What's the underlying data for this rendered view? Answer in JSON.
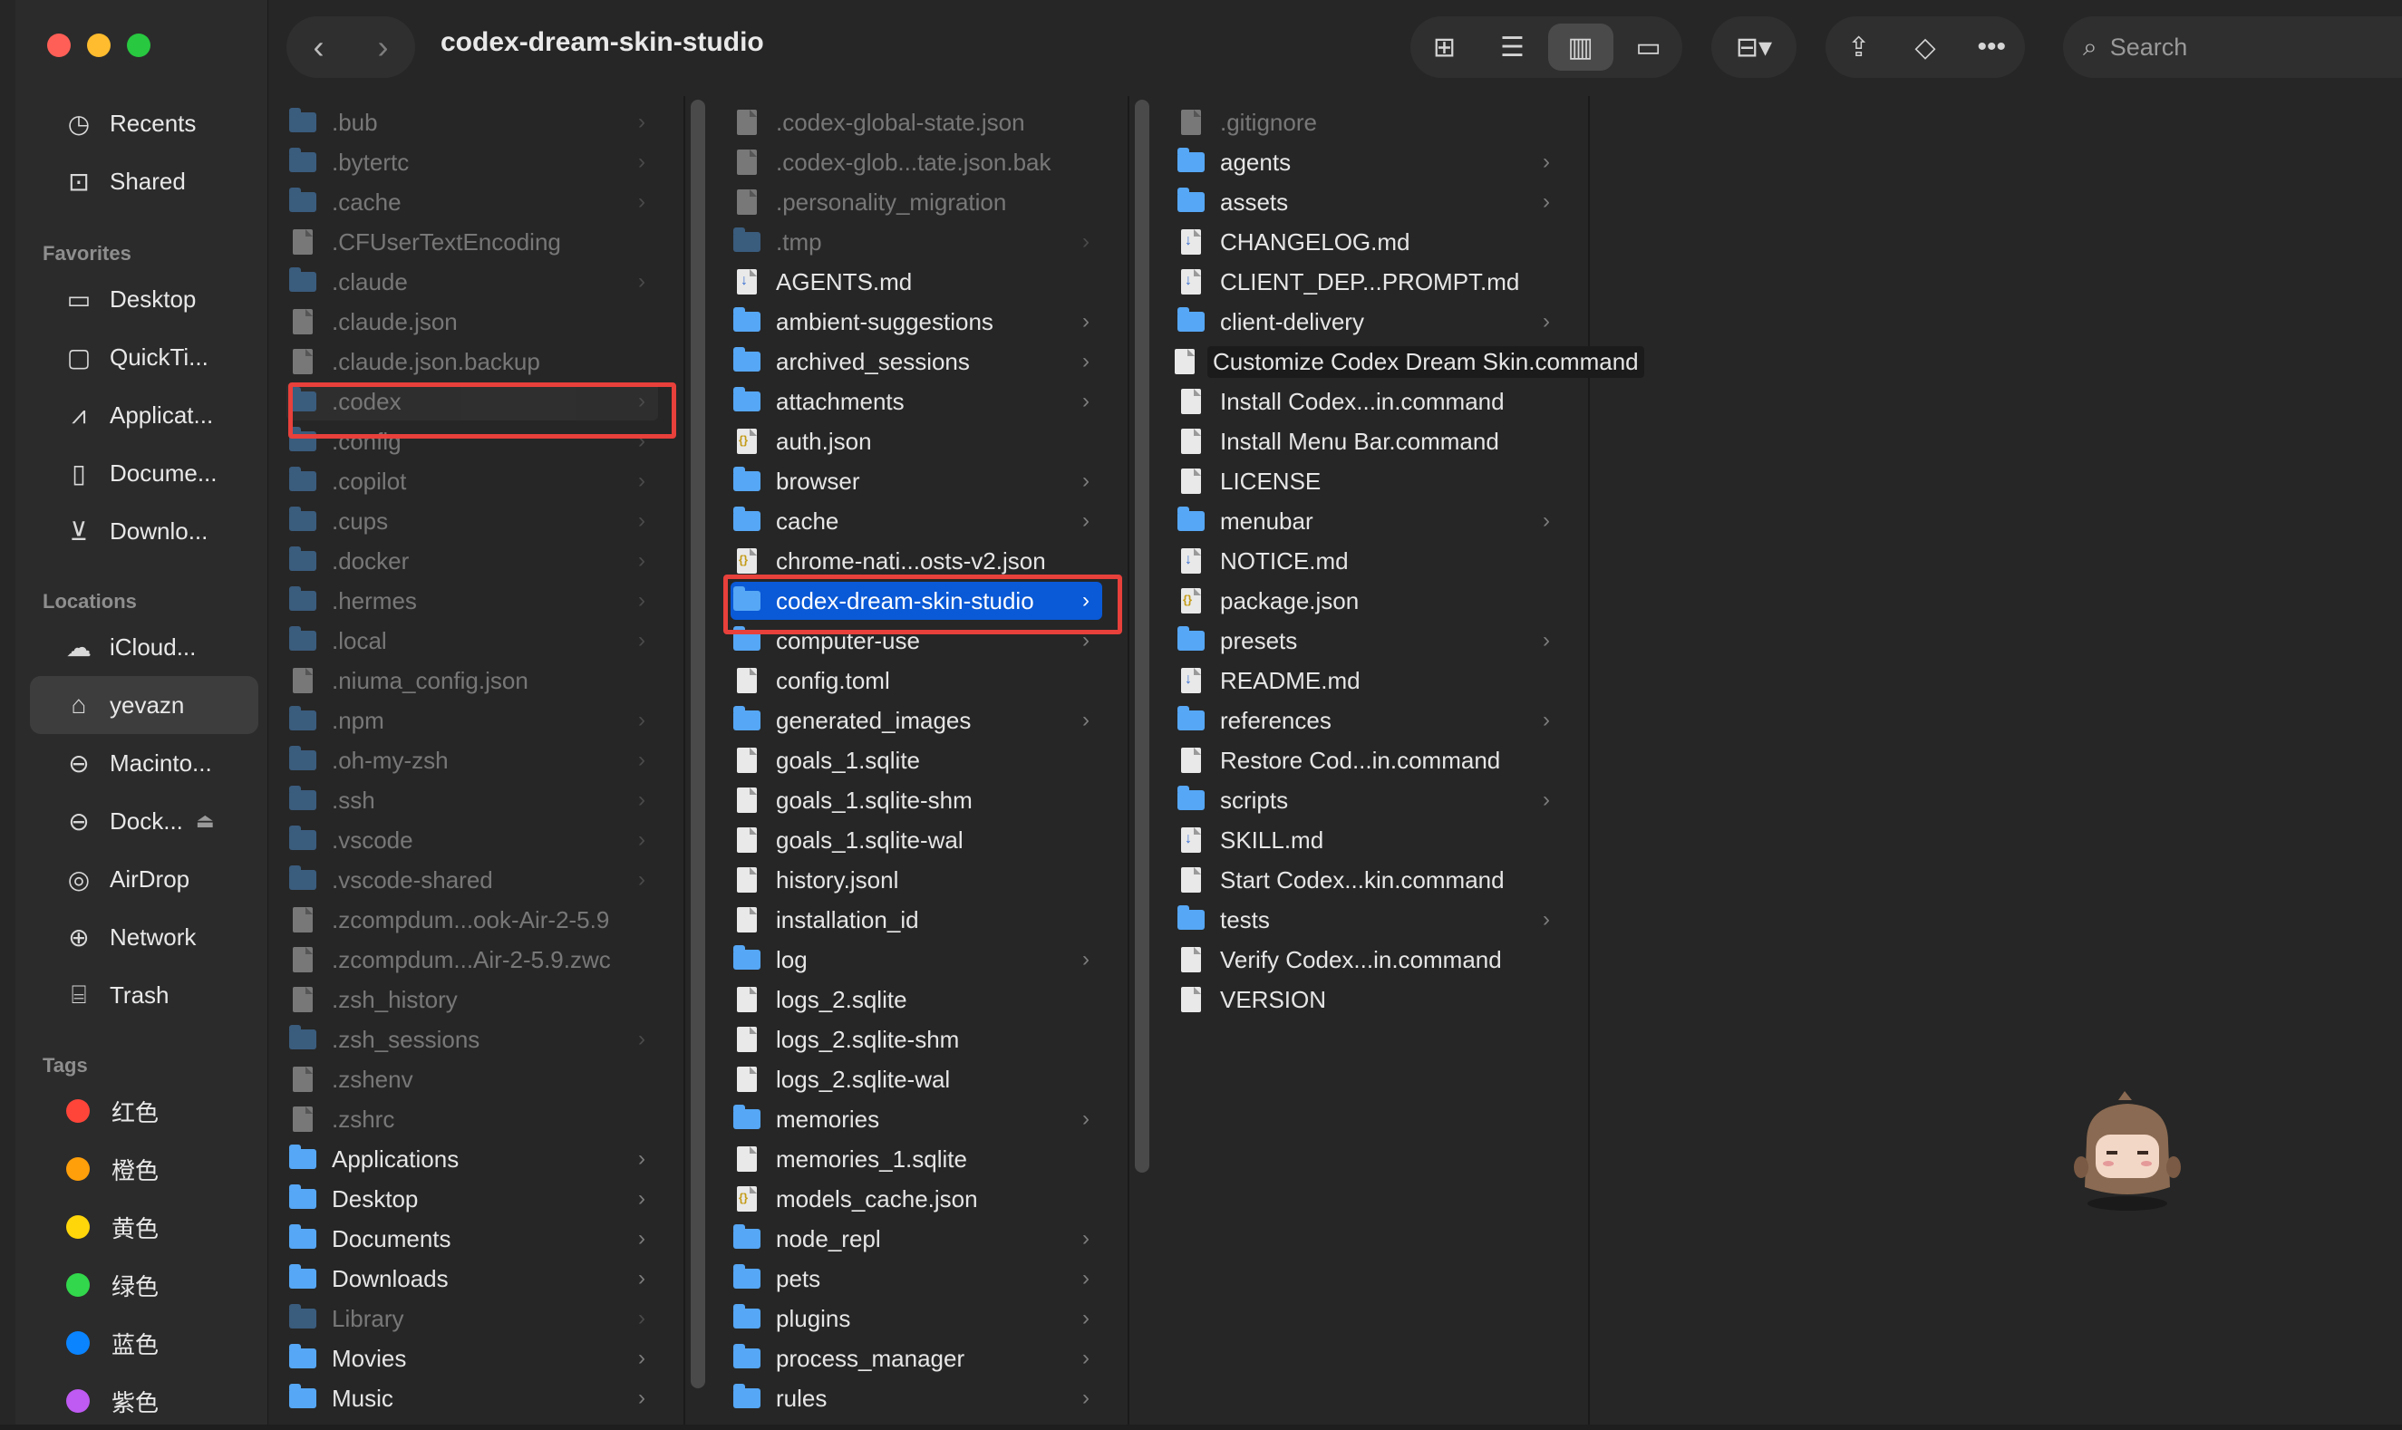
{
  "window": {
    "title": "codex-dream-skin-studio"
  },
  "colors": {
    "accent": "#0a59d6",
    "highlight": "#e8403b",
    "folder": "#56a7f5"
  },
  "sidebar": {
    "top_items": [
      {
        "label": "Recents",
        "icon": "clock-icon"
      },
      {
        "label": "Shared",
        "icon": "shared-folder-icon"
      }
    ],
    "favorites_heading": "Favorites",
    "favorites": [
      {
        "label": "Desktop",
        "icon": "desktop-icon"
      },
      {
        "label": "QuickTi...",
        "icon": "folder-icon"
      },
      {
        "label": "Applicat...",
        "icon": "applications-icon"
      },
      {
        "label": "Docume...",
        "icon": "document-icon"
      },
      {
        "label": "Downlo...",
        "icon": "download-icon"
      }
    ],
    "locations_heading": "Locations",
    "locations": [
      {
        "label": "iCloud...",
        "icon": "cloud-icon"
      },
      {
        "label": "yevazn",
        "icon": "home-icon",
        "active": true
      },
      {
        "label": "Macinto...",
        "icon": "disk-icon"
      },
      {
        "label": "Dock...",
        "icon": "disk-icon",
        "eject": true
      },
      {
        "label": "AirDrop",
        "icon": "airdrop-icon"
      },
      {
        "label": "Network",
        "icon": "globe-icon"
      },
      {
        "label": "Trash",
        "icon": "trash-icon"
      }
    ],
    "tags_heading": "Tags",
    "tags": [
      {
        "label": "红色",
        "color": "#ff453a"
      },
      {
        "label": "橙色",
        "color": "#ff9f0a"
      },
      {
        "label": "黄色",
        "color": "#ffd60a"
      },
      {
        "label": "绿色",
        "color": "#32d74b"
      },
      {
        "label": "蓝色",
        "color": "#0a84ff"
      },
      {
        "label": "紫色",
        "color": "#bf5af2"
      }
    ]
  },
  "toolbar": {
    "search_placeholder": "Search",
    "view_icons": [
      "icon-view-icon",
      "list-view-icon",
      "column-view-icon",
      "gallery-view-icon"
    ],
    "group_icon": "group-by-icon",
    "share_icon": "share-icon",
    "tag_icon": "tag-icon",
    "more_icon": "more-icon"
  },
  "columns": [
    {
      "items": [
        {
          "name": ".bub",
          "type": "folder",
          "hidden": true,
          "chevron": true
        },
        {
          "name": ".bytertc",
          "type": "folder",
          "hidden": true,
          "chevron": true
        },
        {
          "name": ".cache",
          "type": "folder",
          "hidden": true,
          "chevron": true
        },
        {
          "name": ".CFUserTextEncoding",
          "type": "doc",
          "hidden": true
        },
        {
          "name": ".claude",
          "type": "folder",
          "hidden": true,
          "chevron": true
        },
        {
          "name": ".claude.json",
          "type": "doc",
          "hidden": true
        },
        {
          "name": ".claude.json.backup",
          "type": "doc",
          "hidden": true
        },
        {
          "name": ".codex",
          "type": "folder",
          "hidden": true,
          "chevron": true,
          "path_selected": true,
          "highlighted": true
        },
        {
          "name": ".config",
          "type": "folder",
          "hidden": true,
          "chevron": true
        },
        {
          "name": ".copilot",
          "type": "folder",
          "hidden": true,
          "chevron": true
        },
        {
          "name": ".cups",
          "type": "folder",
          "hidden": true,
          "chevron": true
        },
        {
          "name": ".docker",
          "type": "folder",
          "hidden": true,
          "chevron": true
        },
        {
          "name": ".hermes",
          "type": "folder",
          "hidden": true,
          "chevron": true
        },
        {
          "name": ".local",
          "type": "folder",
          "hidden": true,
          "chevron": true
        },
        {
          "name": ".niuma_config.json",
          "type": "doc",
          "hidden": true
        },
        {
          "name": ".npm",
          "type": "folder",
          "hidden": true,
          "chevron": true
        },
        {
          "name": ".oh-my-zsh",
          "type": "folder",
          "hidden": true,
          "chevron": true
        },
        {
          "name": ".ssh",
          "type": "folder",
          "hidden": true,
          "chevron": true
        },
        {
          "name": ".vscode",
          "type": "folder",
          "hidden": true,
          "chevron": true
        },
        {
          "name": ".vscode-shared",
          "type": "folder",
          "hidden": true,
          "chevron": true
        },
        {
          "name": ".zcompdum...ook-Air-2-5.9",
          "type": "doc",
          "hidden": true
        },
        {
          "name": ".zcompdum...Air-2-5.9.zwc",
          "type": "doc",
          "hidden": true
        },
        {
          "name": ".zsh_history",
          "type": "doc",
          "hidden": true
        },
        {
          "name": ".zsh_sessions",
          "type": "folder",
          "hidden": true,
          "chevron": true
        },
        {
          "name": ".zshenv",
          "type": "doc",
          "hidden": true
        },
        {
          "name": ".zshrc",
          "type": "doc",
          "hidden": true
        },
        {
          "name": "Applications",
          "type": "folder",
          "chevron": true
        },
        {
          "name": "Desktop",
          "type": "folder",
          "chevron": true
        },
        {
          "name": "Documents",
          "type": "folder",
          "chevron": true
        },
        {
          "name": "Downloads",
          "type": "folder",
          "chevron": true
        },
        {
          "name": "Library",
          "type": "folder",
          "hidden": true,
          "chevron": true
        },
        {
          "name": "Movies",
          "type": "folder",
          "chevron": true
        },
        {
          "name": "Music",
          "type": "folder",
          "chevron": true
        }
      ]
    },
    {
      "items": [
        {
          "name": ".codex-global-state.json",
          "type": "doc",
          "hidden": true
        },
        {
          "name": ".codex-glob...tate.json.bak",
          "type": "doc",
          "hidden": true
        },
        {
          "name": ".personality_migration",
          "type": "doc",
          "hidden": true
        },
        {
          "name": ".tmp",
          "type": "folder",
          "hidden": true,
          "chevron": true
        },
        {
          "name": "AGENTS.md",
          "type": "md"
        },
        {
          "name": "ambient-suggestions",
          "type": "folder",
          "chevron": true
        },
        {
          "name": "archived_sessions",
          "type": "folder",
          "chevron": true
        },
        {
          "name": "attachments",
          "type": "folder",
          "chevron": true
        },
        {
          "name": "auth.json",
          "type": "json"
        },
        {
          "name": "browser",
          "type": "folder",
          "chevron": true
        },
        {
          "name": "cache",
          "type": "folder",
          "chevron": true
        },
        {
          "name": "chrome-nati...osts-v2.json",
          "type": "json"
        },
        {
          "name": "codex-dream-skin-studio",
          "type": "folder",
          "chevron": true,
          "selected": true,
          "highlighted": true
        },
        {
          "name": "computer-use",
          "type": "folder",
          "chevron": true
        },
        {
          "name": "config.toml",
          "type": "doc"
        },
        {
          "name": "generated_images",
          "type": "folder",
          "chevron": true
        },
        {
          "name": "goals_1.sqlite",
          "type": "doc"
        },
        {
          "name": "goals_1.sqlite-shm",
          "type": "doc"
        },
        {
          "name": "goals_1.sqlite-wal",
          "type": "doc"
        },
        {
          "name": "history.jsonl",
          "type": "doc"
        },
        {
          "name": "installation_id",
          "type": "doc"
        },
        {
          "name": "log",
          "type": "folder",
          "chevron": true
        },
        {
          "name": "logs_2.sqlite",
          "type": "doc"
        },
        {
          "name": "logs_2.sqlite-shm",
          "type": "doc"
        },
        {
          "name": "logs_2.sqlite-wal",
          "type": "doc"
        },
        {
          "name": "memories",
          "type": "folder",
          "chevron": true
        },
        {
          "name": "memories_1.sqlite",
          "type": "doc"
        },
        {
          "name": "models_cache.json",
          "type": "json"
        },
        {
          "name": "node_repl",
          "type": "folder",
          "chevron": true
        },
        {
          "name": "pets",
          "type": "folder",
          "chevron": true
        },
        {
          "name": "plugins",
          "type": "folder",
          "chevron": true
        },
        {
          "name": "process_manager",
          "type": "folder",
          "chevron": true
        },
        {
          "name": "rules",
          "type": "folder",
          "chevron": true
        }
      ]
    },
    {
      "items": [
        {
          "name": ".gitignore",
          "type": "doc",
          "hidden": true
        },
        {
          "name": "agents",
          "type": "folder",
          "chevron": true
        },
        {
          "name": "assets",
          "type": "folder",
          "chevron": true
        },
        {
          "name": "CHANGELOG.md",
          "type": "md"
        },
        {
          "name": "CLIENT_DEP...PROMPT.md",
          "type": "md"
        },
        {
          "name": "client-delivery",
          "type": "folder",
          "chevron": true
        },
        {
          "name": "Customize Codex Dream Skin.command",
          "type": "doc",
          "tooltip": true
        },
        {
          "name": "Install Codex...in.command",
          "type": "doc"
        },
        {
          "name": "Install Menu Bar.command",
          "type": "doc"
        },
        {
          "name": "LICENSE",
          "type": "doc"
        },
        {
          "name": "menubar",
          "type": "folder",
          "chevron": true
        },
        {
          "name": "NOTICE.md",
          "type": "md"
        },
        {
          "name": "package.json",
          "type": "json"
        },
        {
          "name": "presets",
          "type": "folder",
          "chevron": true
        },
        {
          "name": "README.md",
          "type": "md"
        },
        {
          "name": "references",
          "type": "folder",
          "chevron": true
        },
        {
          "name": "Restore Cod...in.command",
          "type": "doc"
        },
        {
          "name": "scripts",
          "type": "folder",
          "chevron": true
        },
        {
          "name": "SKILL.md",
          "type": "md"
        },
        {
          "name": "Start Codex...kin.command",
          "type": "doc"
        },
        {
          "name": "tests",
          "type": "folder",
          "chevron": true
        },
        {
          "name": "Verify Codex...in.command",
          "type": "doc"
        },
        {
          "name": "VERSION",
          "type": "doc"
        }
      ]
    }
  ]
}
